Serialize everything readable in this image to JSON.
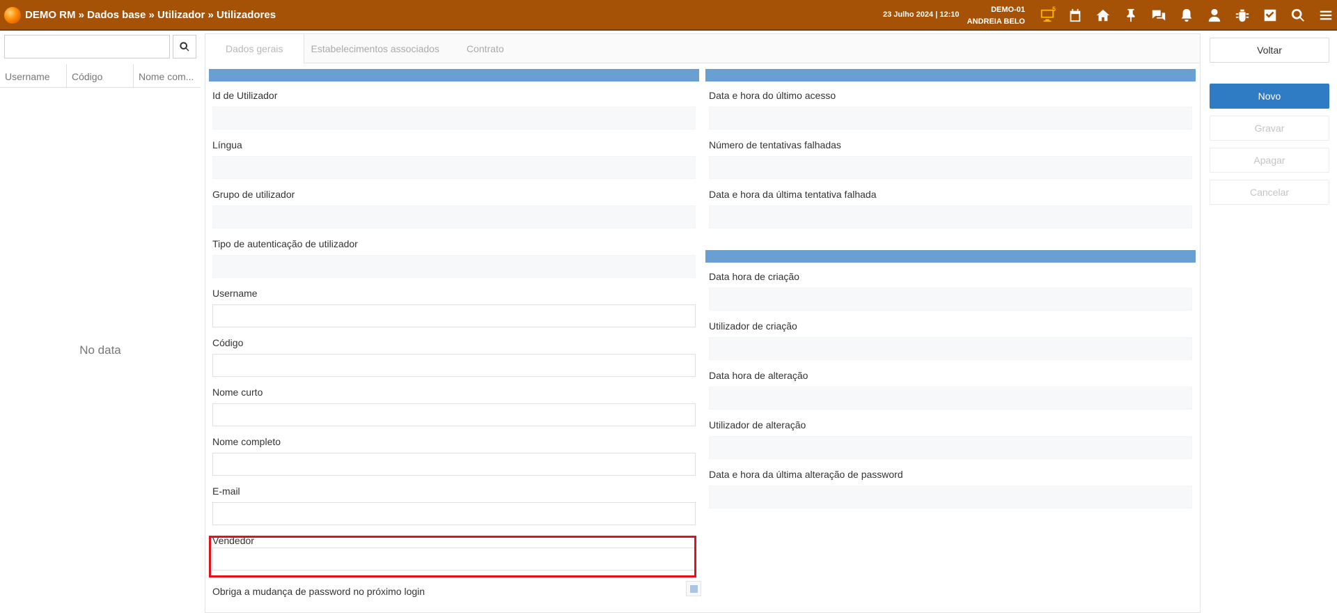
{
  "header": {
    "breadcrumb": "DEMO RM » Dados base » Utilizador » Utilizadores",
    "datetime": "23 Julho 2024 | 12:10",
    "environment": "DEMO-01",
    "user": "ANDREIA BELO",
    "monitor_badge": "5",
    "icons": [
      "monitor-icon",
      "calendar-icon",
      "home-icon",
      "pin-icon",
      "chat-icon",
      "bell-icon",
      "user-icon",
      "bug-icon",
      "check-square-icon",
      "search-icon",
      "menu-icon"
    ]
  },
  "list": {
    "search_value": "",
    "columns": [
      "Username",
      "Código",
      "Nome com..."
    ],
    "empty_text": "No data"
  },
  "tabs": [
    "Dados gerais",
    "Estabelecimentos associados",
    "Contrato"
  ],
  "left_fields": [
    {
      "label": "Id de Utilizador",
      "value": ""
    },
    {
      "label": "Língua",
      "value": ""
    },
    {
      "label": "Grupo de utilizador",
      "value": ""
    },
    {
      "label": "Tipo de autenticação de utilizador",
      "value": ""
    },
    {
      "label": "Username",
      "value": ""
    },
    {
      "label": "Código",
      "value": ""
    },
    {
      "label": "Nome curto",
      "value": ""
    },
    {
      "label": "Nome completo",
      "value": ""
    },
    {
      "label": "E-mail",
      "value": ""
    },
    {
      "label": "Vendedor",
      "value": ""
    }
  ],
  "checkbox_label": "Obriga a mudança de password no próximo login",
  "right_fields_top": [
    {
      "label": "Data e hora do último acesso",
      "value": ""
    },
    {
      "label": "Número de tentativas falhadas",
      "value": ""
    },
    {
      "label": "Data e hora da última tentativa falhada",
      "value": ""
    }
  ],
  "right_fields_bottom": [
    {
      "label": "Data hora de criação",
      "value": ""
    },
    {
      "label": "Utilizador de criação",
      "value": ""
    },
    {
      "label": "Data hora de alteração",
      "value": ""
    },
    {
      "label": "Utilizador de alteração",
      "value": ""
    },
    {
      "label": "Data e hora da última alteração de password",
      "value": ""
    }
  ],
  "actions": {
    "back": "Voltar",
    "new": "Novo",
    "save": "Gravar",
    "delete": "Apagar",
    "cancel": "Cancelar"
  },
  "colors": {
    "topbar": "#a65206",
    "section_bar": "#6a9fd4",
    "primary_button": "#2f7cc4",
    "highlight": "#e0131d"
  }
}
